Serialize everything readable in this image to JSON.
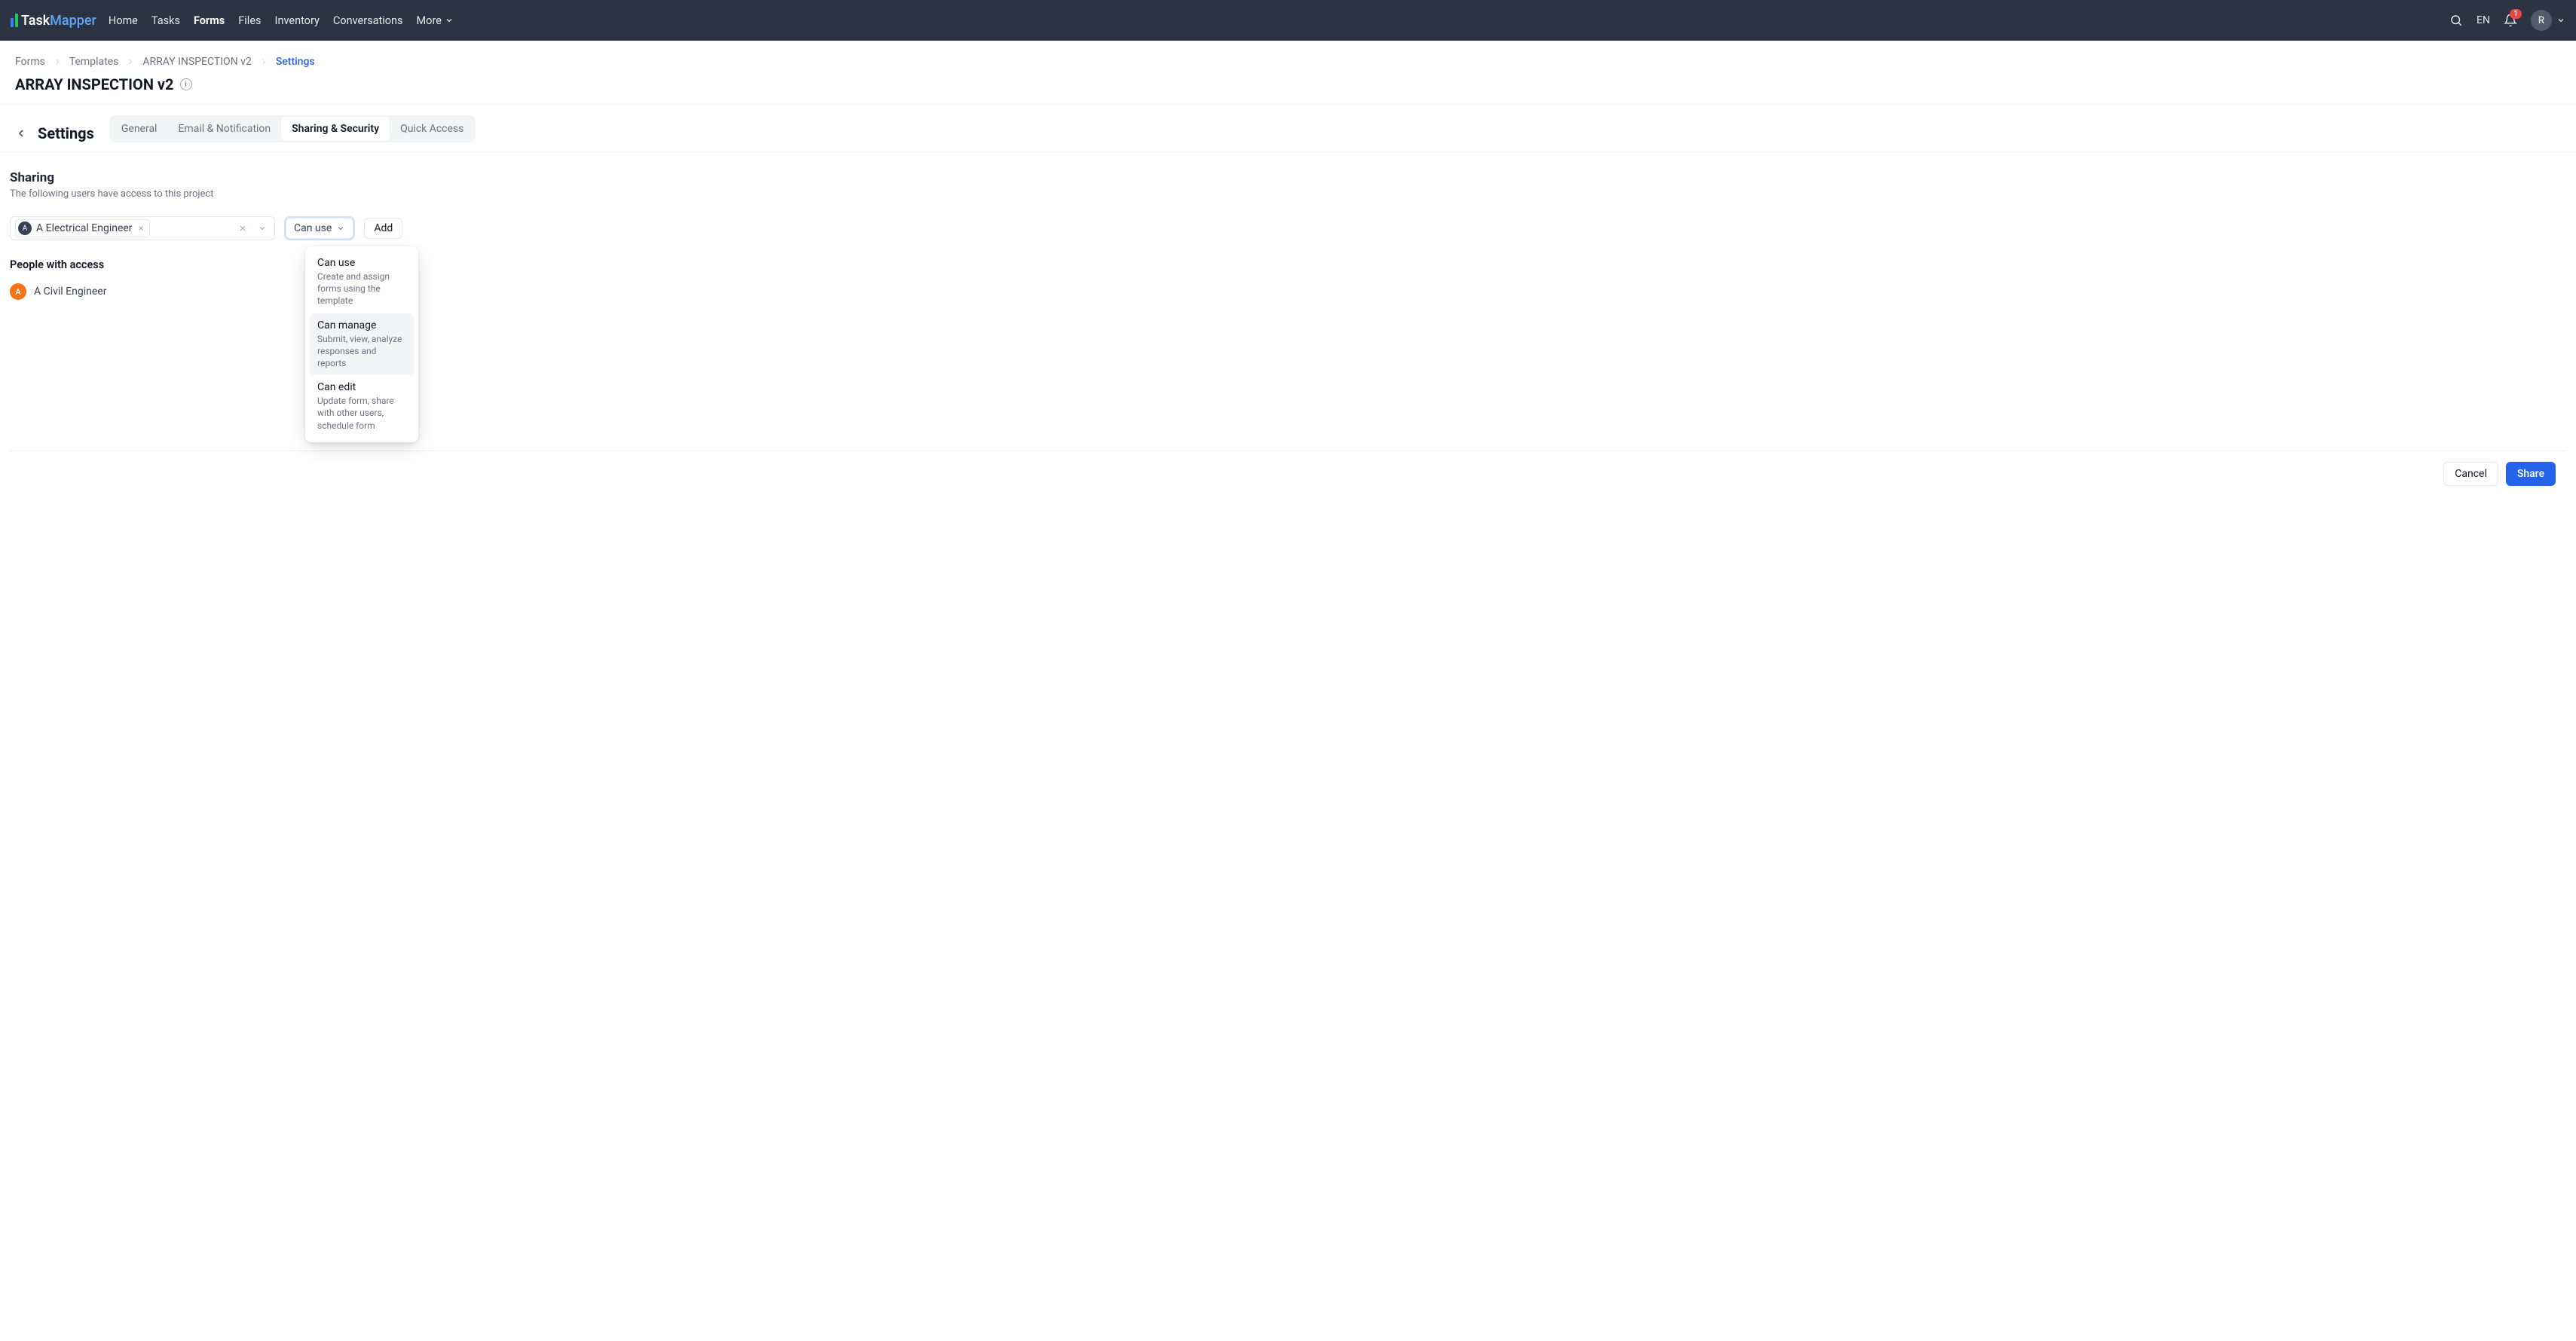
{
  "brand": {
    "a": "Task",
    "b": "Mapper"
  },
  "nav": {
    "items": [
      {
        "label": "Home",
        "active": false
      },
      {
        "label": "Tasks",
        "active": false
      },
      {
        "label": "Forms",
        "active": true
      },
      {
        "label": "Files",
        "active": false
      },
      {
        "label": "Inventory",
        "active": false
      },
      {
        "label": "Conversations",
        "active": false
      }
    ],
    "more": "More"
  },
  "topright": {
    "lang": "EN",
    "notif_count": "1",
    "avatar_initial": "R"
  },
  "breadcrumb": {
    "items": [
      "Forms",
      "Templates",
      "ARRAY INSPECTION v2",
      "Settings"
    ]
  },
  "page_title": "ARRAY INSPECTION v2",
  "settings": {
    "label": "Settings",
    "tabs": [
      "General",
      "Email & Notification",
      "Sharing & Security",
      "Quick Access"
    ]
  },
  "sharing": {
    "title": "Sharing",
    "subtitle": "The following users have access to this project",
    "selected_chip": {
      "initial": "A",
      "name": "A Electrical Engineer"
    },
    "perm_label": "Can use",
    "add_label": "Add",
    "people_title": "People with access",
    "people": [
      {
        "initial": "A",
        "name": "A Civil Engineer"
      }
    ],
    "dropdown": [
      {
        "title": "Can use",
        "desc": "Create and assign forms using the template"
      },
      {
        "title": "Can manage",
        "desc": "Submit, view, analyze responses and reports"
      },
      {
        "title": "Can edit",
        "desc": "Update form, share with other users, schedule form"
      }
    ]
  },
  "footer": {
    "cancel": "Cancel",
    "share": "Share"
  }
}
